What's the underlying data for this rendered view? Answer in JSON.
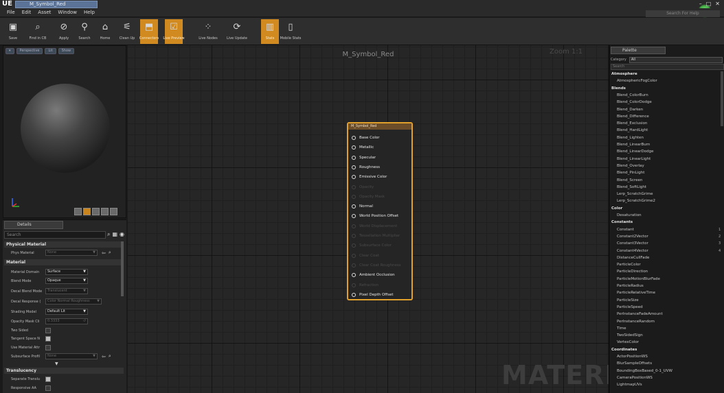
{
  "window": {
    "app_logo": "UE",
    "tab_title": "M_Symbol_Red",
    "controls": [
      "–",
      "□",
      "✕"
    ],
    "help_search_placeholder": "Search For Help"
  },
  "menu": [
    "File",
    "Edit",
    "Asset",
    "Window",
    "Help"
  ],
  "toolbar": [
    {
      "label": "Save",
      "icon": "save-icon",
      "active": false
    },
    {
      "label": "Find in CB",
      "icon": "magnifier-icon",
      "active": false
    },
    {
      "label": "Apply",
      "icon": "apply-icon",
      "active": false
    },
    {
      "label": "Search",
      "icon": "binoculars-icon",
      "active": false
    },
    {
      "label": "Home",
      "icon": "home-icon",
      "active": false
    },
    {
      "label": "Clean Up",
      "icon": "broom-icon",
      "active": false
    },
    {
      "label": "Connectors",
      "icon": "connectors-icon",
      "active": true
    },
    {
      "label": "Live Preview",
      "icon": "live-preview-icon",
      "active": true
    },
    {
      "label": "Live Nodes",
      "icon": "live-nodes-icon",
      "active": false
    },
    {
      "label": "Live Update",
      "icon": "live-update-icon",
      "active": false
    },
    {
      "label": "Stats",
      "icon": "stats-icon",
      "active": true
    },
    {
      "label": "Mobile Stats",
      "icon": "mobile-stats-icon",
      "active": false
    }
  ],
  "viewport": {
    "buttons": [
      "Perspective",
      "Lit",
      "Show"
    ]
  },
  "details": {
    "tab": "Details",
    "search_placeholder": "Search",
    "sections": {
      "physical": "Physical Material",
      "material": "Material",
      "translucency": "Translucency"
    },
    "props": {
      "phys_material": {
        "label": "Phys Material",
        "value": "None"
      },
      "material_domain": {
        "label": "Material Domain",
        "value": "Surface"
      },
      "blend_mode": {
        "label": "Blend Mode",
        "value": "Opaque"
      },
      "decal_blend": {
        "label": "Decal Blend Mode",
        "value": "Translucent"
      },
      "decal_response": {
        "label": "Decal Response (",
        "value": "Color Normal Roughness"
      },
      "shading_model": {
        "label": "Shading Model",
        "value": "Default Lit"
      },
      "opacity_mask": {
        "label": "Opacity Mask Cli",
        "value": "0.3333"
      },
      "two_sided": {
        "label": "Two Sided"
      },
      "tangent_space": {
        "label": "Tangent Space N"
      },
      "use_material_attr": {
        "label": "Use Material Attr"
      },
      "subsurface": {
        "label": "Subsurface Profil",
        "value": "None"
      },
      "separate_transl": {
        "label": "Separate Translu"
      },
      "responsive_aa": {
        "label": "Responsive AA"
      }
    }
  },
  "graph": {
    "title": "M_Symbol_Red",
    "zoom": "Zoom 1:1",
    "watermark": "MATERIAL"
  },
  "node": {
    "title": "M_Symbol_Red",
    "pins": [
      {
        "label": "Base Color",
        "enabled": true
      },
      {
        "label": "Metallic",
        "enabled": true
      },
      {
        "label": "Specular",
        "enabled": true
      },
      {
        "label": "Roughness",
        "enabled": true
      },
      {
        "label": "Emissive Color",
        "enabled": true
      },
      {
        "label": "Opacity",
        "enabled": false
      },
      {
        "label": "Opacity Mask",
        "enabled": false
      },
      {
        "label": "Normal",
        "enabled": true
      },
      {
        "label": "World Position Offset",
        "enabled": true
      },
      {
        "label": "World Displacement",
        "enabled": false
      },
      {
        "label": "Tessellation Multiplier",
        "enabled": false
      },
      {
        "label": "Subsurface Color",
        "enabled": false
      },
      {
        "label": "Clear Coat",
        "enabled": false
      },
      {
        "label": "Clear Coat Roughness",
        "enabled": false
      },
      {
        "label": "Ambient Occlusion",
        "enabled": true
      },
      {
        "label": "Refraction",
        "enabled": false
      },
      {
        "label": "Pixel Depth Offset",
        "enabled": true
      }
    ]
  },
  "palette": {
    "tab": "Palette",
    "category_label": "Category",
    "category_value": "All",
    "search_placeholder": "Search",
    "entries": [
      {
        "type": "cat",
        "text": "Atmosphere"
      },
      {
        "type": "item",
        "text": "AtmosphericFogColor"
      },
      {
        "type": "cat",
        "text": "Blends"
      },
      {
        "type": "item",
        "text": "Blend_ColorBurn"
      },
      {
        "type": "item",
        "text": "Blend_ColorDodge"
      },
      {
        "type": "item",
        "text": "Blend_Darken"
      },
      {
        "type": "item",
        "text": "Blend_Difference"
      },
      {
        "type": "item",
        "text": "Blend_Exclusion"
      },
      {
        "type": "item",
        "text": "Blend_HardLight"
      },
      {
        "type": "item",
        "text": "Blend_Lighten"
      },
      {
        "type": "item",
        "text": "Blend_LinearBurn"
      },
      {
        "type": "item",
        "text": "Blend_LinearDodge"
      },
      {
        "type": "item",
        "text": "Blend_LinearLight"
      },
      {
        "type": "item",
        "text": "Blend_Overlay"
      },
      {
        "type": "item",
        "text": "Blend_PinLight"
      },
      {
        "type": "item",
        "text": "Blend_Screen"
      },
      {
        "type": "item",
        "text": "Blend_SoftLight"
      },
      {
        "type": "item",
        "text": "Lerp_ScratchGrime"
      },
      {
        "type": "item",
        "text": "Lerp_ScratchGrime2"
      },
      {
        "type": "cat",
        "text": "Color"
      },
      {
        "type": "item",
        "text": "Desaturation"
      },
      {
        "type": "cat",
        "text": "Constants"
      },
      {
        "type": "item",
        "text": "Constant",
        "num": "1"
      },
      {
        "type": "item",
        "text": "Constant2Vector",
        "num": "2"
      },
      {
        "type": "item",
        "text": "Constant3Vector",
        "num": "3"
      },
      {
        "type": "item",
        "text": "Constant4Vector",
        "num": "4"
      },
      {
        "type": "item",
        "text": "DistanceCullFade"
      },
      {
        "type": "item",
        "text": "ParticleColor"
      },
      {
        "type": "item",
        "text": "ParticleDirection"
      },
      {
        "type": "item",
        "text": "ParticleMotionBlurFade"
      },
      {
        "type": "item",
        "text": "ParticleRadius"
      },
      {
        "type": "item",
        "text": "ParticleRelativeTime"
      },
      {
        "type": "item",
        "text": "ParticleSize"
      },
      {
        "type": "item",
        "text": "ParticleSpeed"
      },
      {
        "type": "item",
        "text": "PerInstanceFadeAmount"
      },
      {
        "type": "item",
        "text": "PerInstanceRandom"
      },
      {
        "type": "item",
        "text": "Time"
      },
      {
        "type": "item",
        "text": "TwoSidedSign"
      },
      {
        "type": "item",
        "text": "VertexColor"
      },
      {
        "type": "cat",
        "text": "Coordinates"
      },
      {
        "type": "item",
        "text": "ActorPositionWS"
      },
      {
        "type": "item",
        "text": "BlurSampleOffsets"
      },
      {
        "type": "item",
        "text": "BoundingBoxBased_0-1_UVW"
      },
      {
        "type": "item",
        "text": "CameraPositionWS"
      },
      {
        "type": "item",
        "text": "LightmapUVs"
      }
    ]
  }
}
